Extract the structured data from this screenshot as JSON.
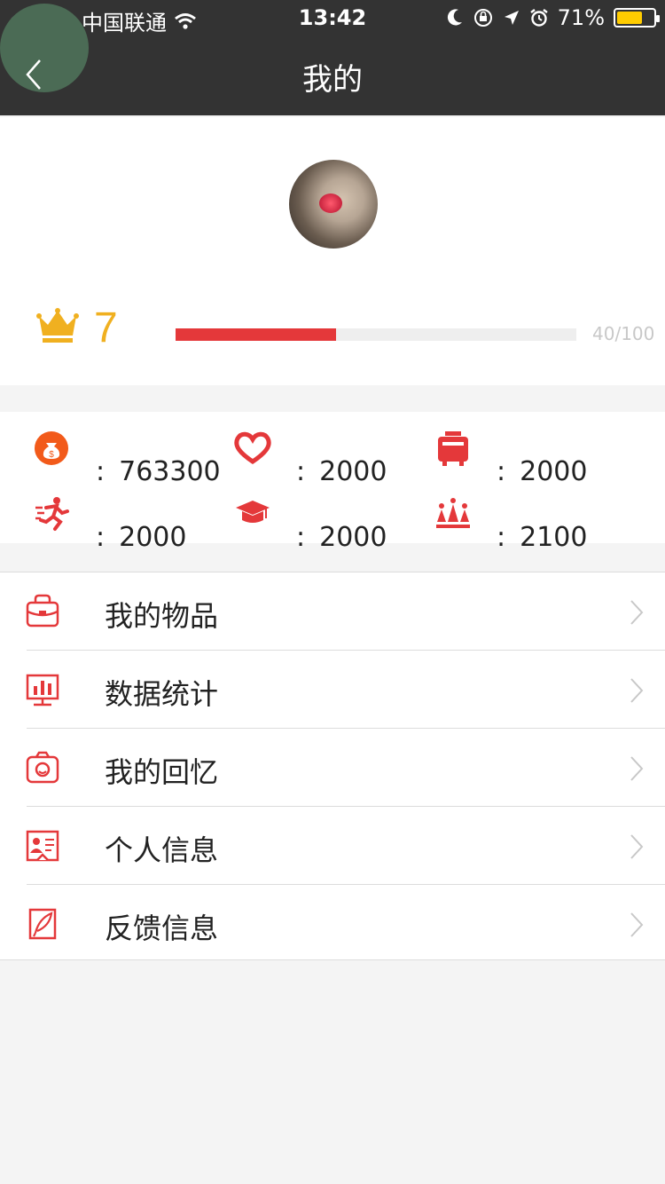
{
  "status_bar": {
    "carrier": "中国联通",
    "time": "13:42",
    "battery_percent": "71%",
    "battery_level": 0.71
  },
  "header": {
    "title": "我的"
  },
  "profile": {
    "level": "7",
    "progress_text": "40/100",
    "progress_fraction": 0.4
  },
  "stats": [
    {
      "icon": "money-bag-icon",
      "value": "763300",
      "color": "#f25a1a"
    },
    {
      "icon": "heart-icon",
      "value": "2000",
      "color": "#e4383a"
    },
    {
      "icon": "pot-icon",
      "value": "2000",
      "color": "#e4383a"
    },
    {
      "icon": "running-man-icon",
      "value": "2000",
      "color": "#e4383a"
    },
    {
      "icon": "graduation-cap-icon",
      "value": "2000",
      "color": "#e4383a"
    },
    {
      "icon": "crowd-icon",
      "value": "2100",
      "color": "#e4383a"
    }
  ],
  "stat_colon": ":",
  "menu": [
    {
      "icon": "bag-icon",
      "label": "我的物品"
    },
    {
      "icon": "chart-monitor-icon",
      "label": "数据统计"
    },
    {
      "icon": "camera-icon",
      "label": "我的回忆"
    },
    {
      "icon": "id-card-icon",
      "label": "个人信息"
    },
    {
      "icon": "feather-pen-icon",
      "label": "反馈信息"
    }
  ],
  "colors": {
    "header_bg": "#333333",
    "accent_red": "#e4383a",
    "level_gold": "#f0b020"
  }
}
